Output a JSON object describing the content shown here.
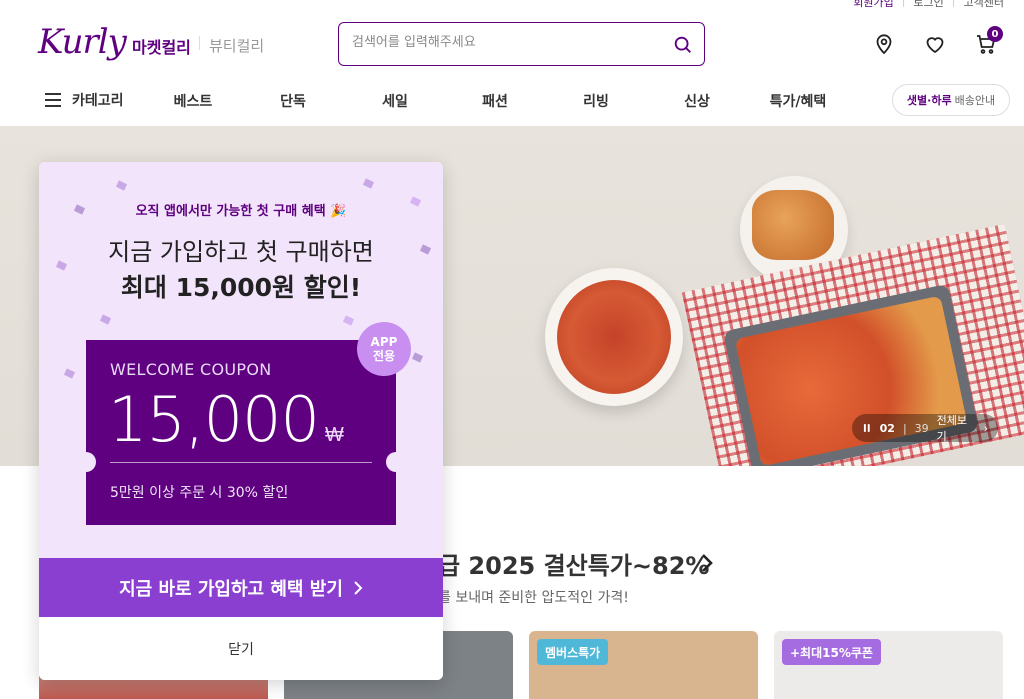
{
  "top_links": {
    "join": "회원가입",
    "login": "로그인",
    "service": "고객센터"
  },
  "header": {
    "logo": "Kurly",
    "market_tab": "마켓컬리",
    "beauty_tab": "뷰티컬리",
    "search_placeholder": "검색어를 입력해주세요",
    "cart_count": "0"
  },
  "nav": {
    "category_label": "카테고리",
    "items": [
      "베스트",
      "단독",
      "세일",
      "패션",
      "리빙",
      "신상",
      "특가/혜택"
    ],
    "delivery_highlight": "샛별·하루",
    "delivery_rest": "배송안내"
  },
  "banner": {
    "player_current": "02",
    "player_total": "39",
    "player_view_all": "전체보기"
  },
  "section": {
    "title": "급 2025 결산특가~82%",
    "subtitle": "를 보내며 준비한 압도적인 가격!"
  },
  "cards": [
    {
      "badge": ""
    },
    {
      "badge": ""
    },
    {
      "badge": "멤버스특가",
      "color": "#4fb8d8"
    },
    {
      "badge": "+최대15%쿠폰",
      "color": "#a56be0"
    }
  ],
  "popup": {
    "small_text": "오직 앱에서만 가능한 첫 구매 혜택 🎉",
    "line1": "지금 가입하고 첫 구매하면",
    "line2": "최대 15,000원 할인!",
    "coupon_title": "WELCOME COUPON",
    "coupon_amount": "15,000",
    "coupon_currency": "₩",
    "coupon_condition": "5만원 이상 주문 시 30% 할인",
    "app_badge_line1": "APP",
    "app_badge_line2": "전용",
    "cta_label": "지금 바로 가입하고 혜택 받기",
    "close_label": "닫기"
  },
  "colors": {
    "brand": "#5f0080",
    "cta": "#8a3fd0",
    "popup_bg": "#f2e4fb"
  }
}
